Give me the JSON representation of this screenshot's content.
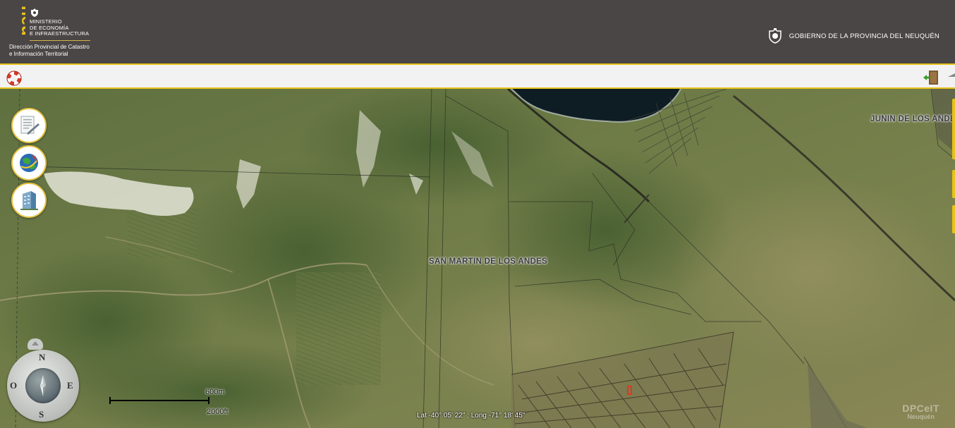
{
  "header": {
    "ministry_line1": "MINISTERIO",
    "ministry_line2": "DE ECONOMÍA",
    "ministry_line3": "E INFRAESTRUCTURA",
    "direccion_line1": "Dirección Provincial de Catastro",
    "direccion_line2": "e Información Territorial",
    "government": "GOBIERNO DE LA PROVINCIA DEL NEUQUÉN",
    "logo_icon": "neu-logo",
    "crest_icon": "provincial-crest-icon"
  },
  "toolbar": {
    "help_icon": "lifebuoy-icon",
    "exit_icon": "exit-door-icon",
    "collapse_icon": "collapse-arrow-icon"
  },
  "map": {
    "labels": {
      "san_martin": "SAN MARTIN DE LOS ANDES",
      "junin": "JUNIN DE LOS ANDES"
    },
    "tools": [
      {
        "name": "document-tool",
        "icon": "document-pen-icon"
      },
      {
        "name": "layers-tool",
        "icon": "globe-layers-icon"
      },
      {
        "name": "building-tool",
        "icon": "building-icon"
      }
    ],
    "compass": {
      "north": "N",
      "south": "S",
      "east": "E",
      "west": "O"
    },
    "scale": {
      "metric": "600m",
      "imperial": "2000ft"
    },
    "coordinates": "Lat -40° 05' 22\" ; Long -71° 18' 45\"",
    "watermark": {
      "line1": "DPCeIT",
      "line2": "Neuquén"
    },
    "colors": {
      "accent": "#e8c21a",
      "header_bg": "#4a4645",
      "toolbar_bg": "#f2f2f2",
      "highlight_parcel": "#e83323"
    }
  }
}
